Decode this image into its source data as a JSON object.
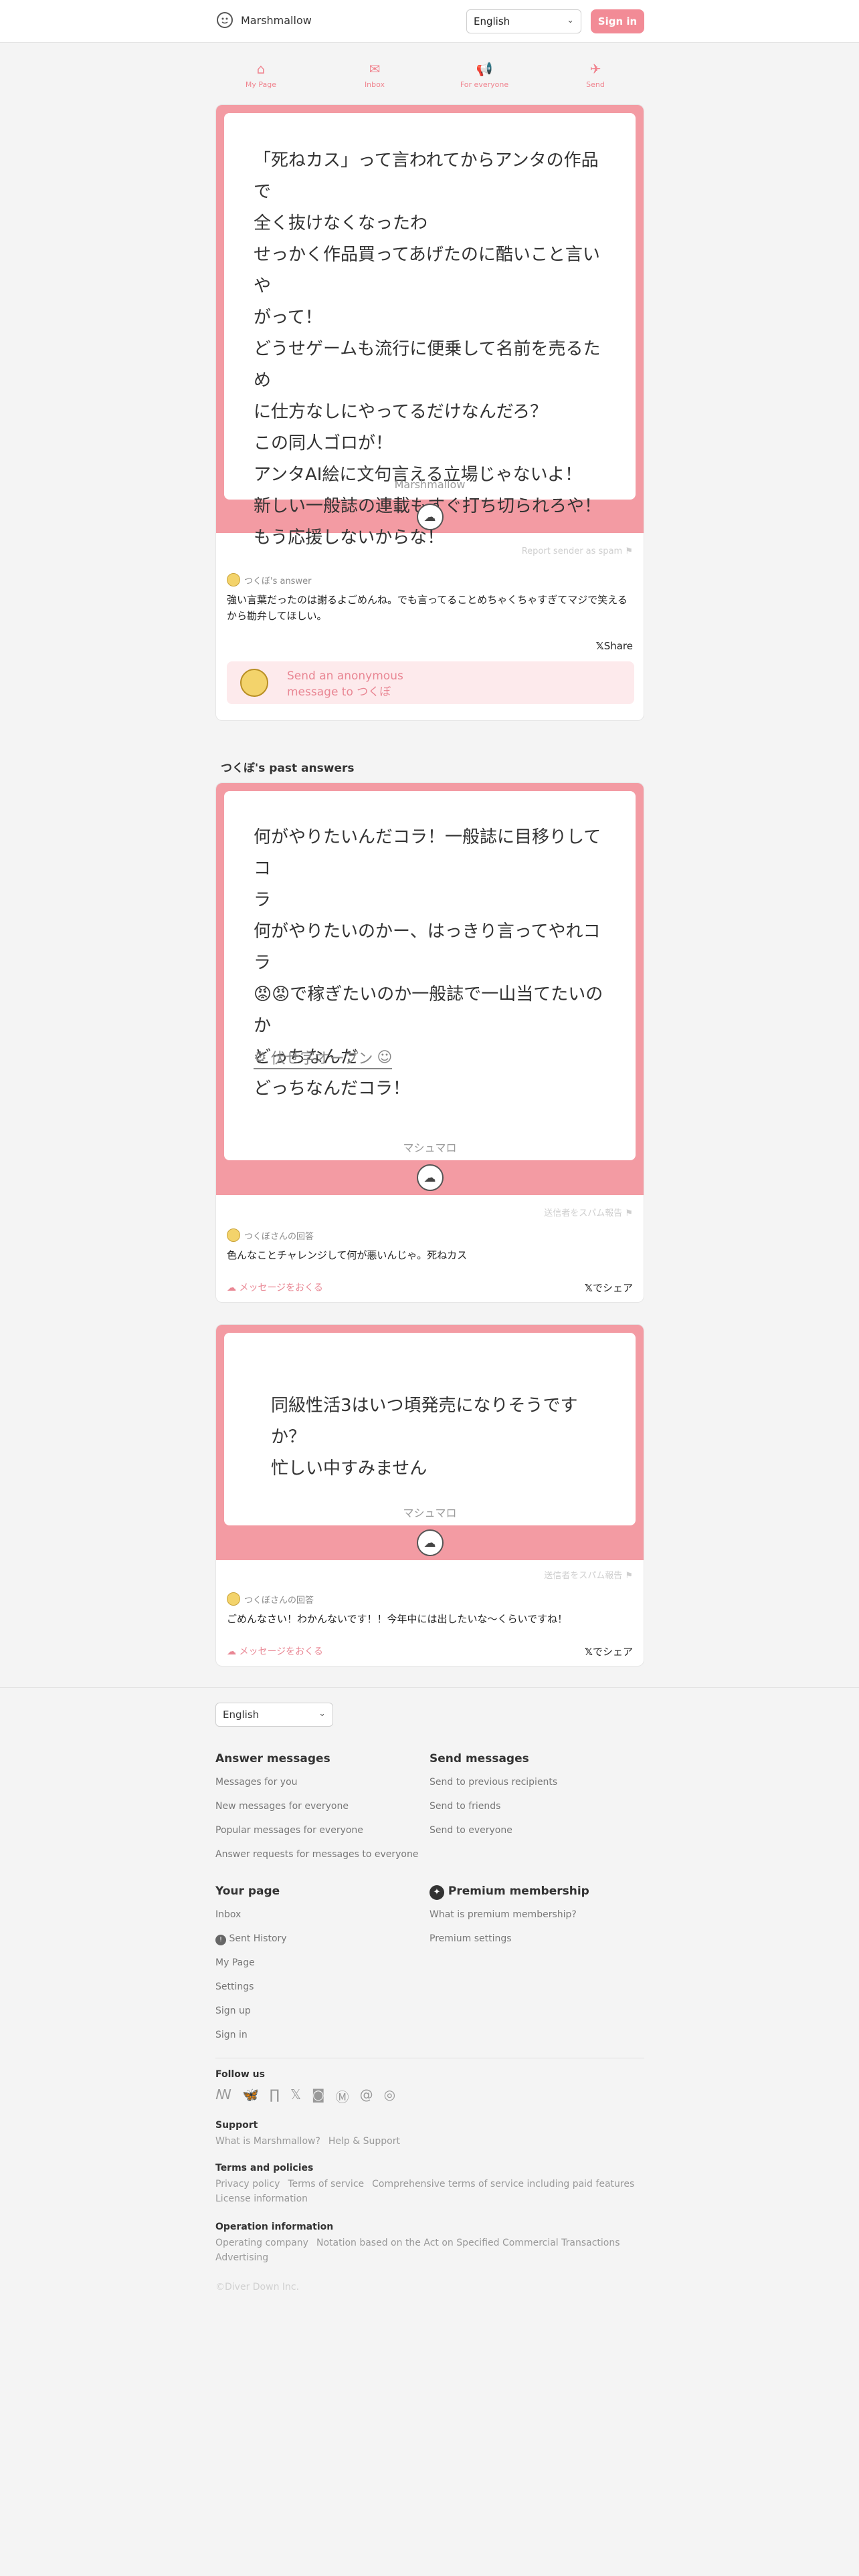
{
  "header": {
    "logo_text": "Marshmallow",
    "language": "English",
    "signin_label": "Sign in"
  },
  "nav": [
    {
      "icon": "home-icon",
      "glyph": "⌂",
      "label": "My Page"
    },
    {
      "icon": "inbox-icon",
      "glyph": "✉",
      "label": "Inbox"
    },
    {
      "icon": "megaphone-icon",
      "glyph": "📢",
      "label": "For everyone"
    },
    {
      "icon": "paper-plane-icon",
      "glyph": "✈",
      "label": "Send"
    }
  ],
  "main_message": {
    "text": "「死ねカス」って言われてからアンタの作品で\n全く抜けなくなったわ\nせっかく作品買ってあげたのに酷いこと言いや\nがって！\nどうせゲームも流行に便乗して名前を売るため\nに仕方なしにやってるだけなんだろ？\nこの同人ゴロが！\nアンタAI絵に文句言える立場じゃないよ！\n新しい一般誌の連載もすぐ打ち切られろや！\nもう応援しないからな！",
    "brand": "Marshmallow",
    "report_label": "Report sender as spam",
    "answerer_label": "つくぼ's answer",
    "answer": "強い言葉だったのは謝るよごめんね。でも言ってることめちゃくちゃすぎてマジで笑えるから勘弁してほしい。",
    "share_label": "Share",
    "send_box": {
      "line1": "Send an anonymous",
      "line2": "message to つくぼ"
    }
  },
  "past_answers_title": "つくぼ's past answers",
  "past_answers": [
    {
      "text": "何がやりたいんだコラ！一般誌に目移りしてコ\nラ\n何がやりたいのかー、はっきり言ってやれコラ\n😡😡で稼ぎたいのか一般誌で一山当てたいのか\nどっちなんだ\nどっちなんだコラ！",
      "hidden_label": "伏せ字オープン",
      "brand": "マシュマロ",
      "report_label": "送信者をスパム報告",
      "answerer_label": "つくぼさんの回答",
      "answer": "色んなことチャレンジして何が悪いんじゃ。死ねカス",
      "send_label": "メッセージをおくる",
      "share_label": "でシェア"
    },
    {
      "text": "同級性活3はいつ頃発売になりそうですか？\n忙しい中すみません",
      "brand": "マシュマロ",
      "report_label": "送信者をスパム報告",
      "answerer_label": "つくぼさんの回答",
      "answer": "ごめんなさい！わかんないです！！今年中には出したいな〜くらいですね！",
      "send_label": "メッセージをおくる",
      "share_label": "でシェア"
    }
  ],
  "footer": {
    "language": "English",
    "answer_messages": {
      "title": "Answer messages",
      "links": [
        "Messages for you",
        "New messages for everyone",
        "Popular messages for everyone",
        "Answer requests for messages to everyone"
      ]
    },
    "send_messages": {
      "title": "Send messages",
      "links": [
        "Send to previous recipients",
        "Send to friends",
        "Send to everyone"
      ]
    },
    "your_page": {
      "title": "Your page",
      "links": [
        "Inbox",
        "Sent History",
        "My Page",
        "Settings",
        "Sign up",
        "Sign in"
      ]
    },
    "premium": {
      "title": "Premium membership",
      "links": [
        "What is premium membership?",
        "Premium settings"
      ]
    },
    "follow_us": "Follow us",
    "socials": [
      "misskey-icon",
      "bluesky-icon",
      "fanbox-icon",
      "x-icon",
      "mastodon-icon",
      "misskey-m-icon",
      "threads-icon",
      "instagram-icon"
    ],
    "support": {
      "title": "Support",
      "links": [
        "What is Marshmallow?",
        "Help & Support"
      ]
    },
    "terms": {
      "title": "Terms and policies",
      "links": [
        "Privacy policy",
        "Terms of service",
        "Comprehensive terms of service including paid features",
        "License information"
      ]
    },
    "operation": {
      "title": "Operation information",
      "links": [
        "Operating company",
        "Notation based on the Act on Specified Commercial Transactions",
        "Advertising"
      ]
    },
    "copyright": "©Diver Down Inc."
  }
}
